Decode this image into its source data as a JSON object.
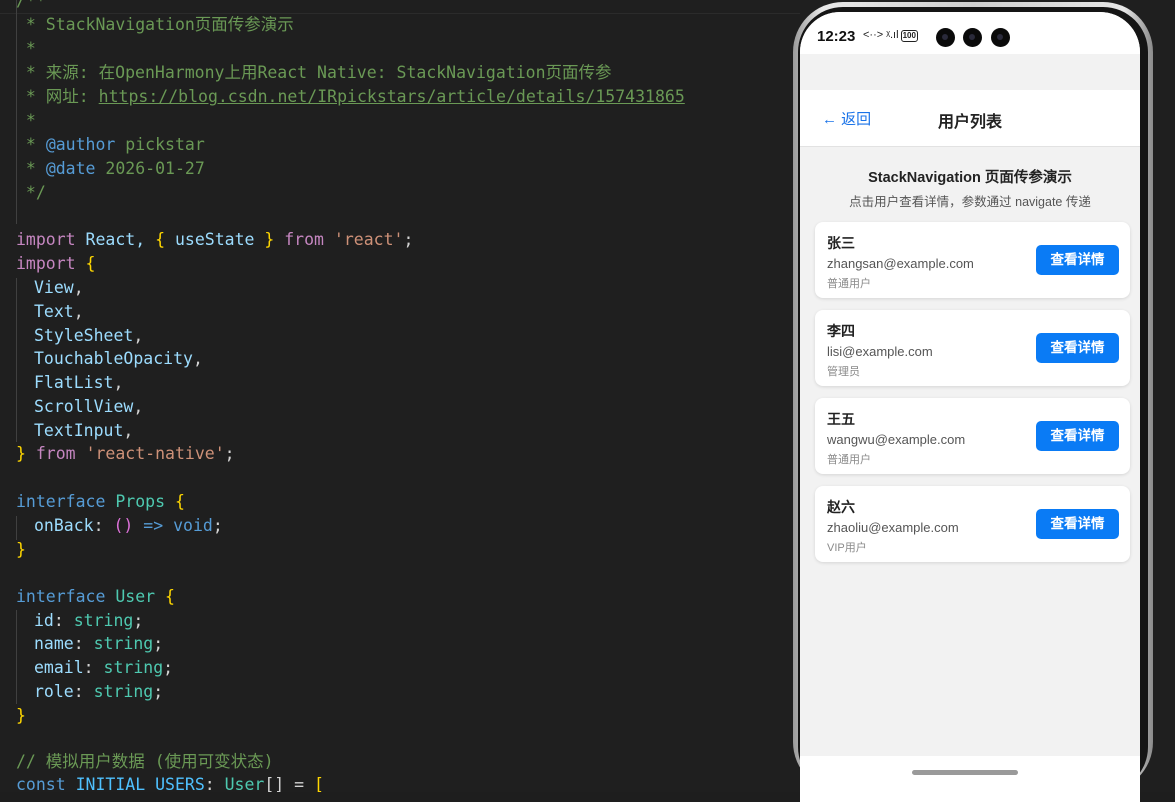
{
  "editor": {
    "lines": [
      {
        "t": "comment",
        "text": "/**"
      },
      {
        "t": "comment",
        "text": " * StackNavigation页面传参演示"
      },
      {
        "t": "comment",
        "text": " *"
      },
      {
        "t": "comment",
        "text": " * 来源: 在OpenHarmony上用React Native: StackNavigation页面传参"
      },
      {
        "t": "comment_url",
        "prefix": " * 网址: ",
        "url": "https://blog.csdn.net/IRpickstars/article/details/157431865"
      },
      {
        "t": "comment",
        "text": " *"
      },
      {
        "t": "tag",
        "prefix": " * ",
        "tag": "@author",
        "rest": " pickstar"
      },
      {
        "t": "tag",
        "prefix": " * ",
        "tag": "@date",
        "rest": " 2026-01-27"
      },
      {
        "t": "comment",
        "text": " */"
      }
    ],
    "code": {
      "import1": [
        "import",
        " React, ",
        "{",
        " useState ",
        "}",
        " from ",
        "'react'",
        ";"
      ],
      "import2_kw": "import",
      "import2_open": "{",
      "imports": [
        "View",
        "Text",
        "StyleSheet",
        "TouchableOpacity",
        "FlatList",
        "ScrollView",
        "TextInput"
      ],
      "import2_close": "}",
      "import2_from": "from",
      "import2_src": "'react-native'",
      "iface1_kw": "interface",
      "iface1_name": "Props",
      "iface1_prop": "onBack",
      "iface1_type": "void",
      "iface2_kw": "interface",
      "iface2_name": "User",
      "iface2_props": [
        {
          "name": "id",
          "type": "string"
        },
        {
          "name": "name",
          "type": "string"
        },
        {
          "name": "email",
          "type": "string"
        },
        {
          "name": "role",
          "type": "string"
        }
      ],
      "comment2": "// 模拟用户数据 (使用可变状态)",
      "const_kw": "const",
      "const_name": "INITIAL_USERS",
      "const_type": "User"
    }
  },
  "phone": {
    "status": {
      "time": "12:23",
      "icons": "<··> ᵡ.ıl",
      "battery": "100"
    },
    "nav": {
      "back_label": "← 返回",
      "title": "用户列表"
    },
    "header": {
      "title": "StackNavigation 页面传参演示",
      "subtitle": "点击用户查看详情，参数通过 navigate 传递"
    },
    "users": [
      {
        "name": "张三",
        "email": "zhangsan@example.com",
        "role": "普通用户"
      },
      {
        "name": "李四",
        "email": "lisi@example.com",
        "role": "管理员"
      },
      {
        "name": "王五",
        "email": "wangwu@example.com",
        "role": "普通用户"
      },
      {
        "name": "赵六",
        "email": "zhaoliu@example.com",
        "role": "VIP用户"
      }
    ],
    "detail_button_label": "查看详情",
    "colors": {
      "accent": "#0a7bf5",
      "link": "#1a73e8"
    }
  }
}
